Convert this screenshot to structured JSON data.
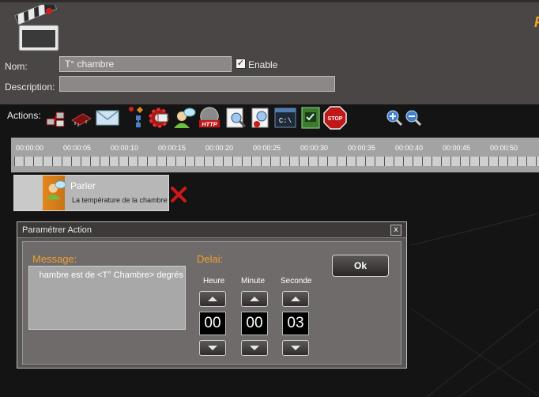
{
  "form": {
    "nom_label": "Nom:",
    "nom_value": "T° chambre",
    "enable_label": "Enable",
    "enable_checked": true,
    "description_label": "Description:",
    "description_value": ""
  },
  "actions": {
    "label": "Actions:",
    "icons": [
      "network-icon",
      "chip-icon",
      "mail-icon",
      "shapes-icon",
      "settings-icon",
      "speak-icon",
      "http-icon",
      "search-icon",
      "record-icon",
      "console-icon",
      "script-icon",
      "stop-icon",
      "zoom-in-icon",
      "zoom-out-icon"
    ],
    "http_text": "HTTP",
    "console_text": "C:\\",
    "stop_text": "STOP"
  },
  "timeline": {
    "labels": [
      "00:00:00",
      "00:00:05",
      "00:00:10",
      "00:00:15",
      "00:00:20",
      "00:00:25",
      "00:00:30",
      "00:00:35",
      "00:00:40",
      "00:00:45",
      "00:00:50"
    ]
  },
  "action_block": {
    "title": "Parler",
    "subtitle": "La température de la chambre"
  },
  "dialog": {
    "title": "Paramétrer Action",
    "close": "x",
    "message_label": "Message:",
    "message_value": "hambre est de <T° Chambre> degrés",
    "delai_label": "Delai:",
    "heure_label": "Heure",
    "minute_label": "Minute",
    "seconde_label": "Seconde",
    "heure_value": "00",
    "minute_value": "00",
    "seconde_value": "03",
    "ok_label": "Ok"
  },
  "colors": {
    "accent": "#f0a030",
    "panel": "#4a4645",
    "background": "#141414"
  }
}
